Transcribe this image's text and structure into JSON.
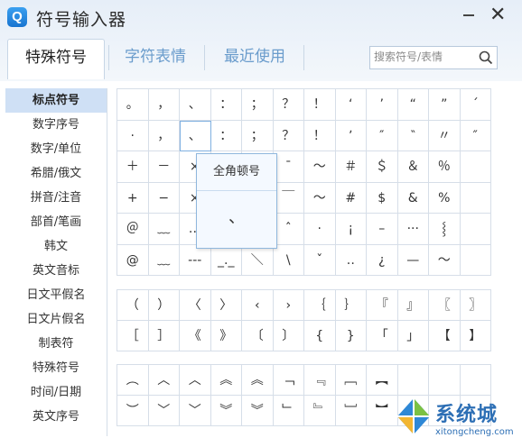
{
  "window": {
    "logo": "Q",
    "title": "符号输入器",
    "min_icon": "minimize-icon",
    "close_icon": "close-icon",
    "close_glyph": "✕"
  },
  "tabs": [
    {
      "label": "特殊符号",
      "active": true
    },
    {
      "label": "字符表情",
      "active": false
    },
    {
      "label": "最近使用",
      "active": false
    }
  ],
  "search": {
    "placeholder": "搜索符号/表情",
    "icon": "search-icon"
  },
  "sidebar": {
    "items": [
      {
        "label": "标点符号",
        "active": true
      },
      {
        "label": "数字序号"
      },
      {
        "label": "数字/单位"
      },
      {
        "label": "希腊/俄文"
      },
      {
        "label": "拼音/注音"
      },
      {
        "label": "部首/笔画"
      },
      {
        "label": "韩文"
      },
      {
        "label": "英文音标"
      },
      {
        "label": "日文平假名"
      },
      {
        "label": "日文片假名"
      },
      {
        "label": "制表符"
      },
      {
        "label": "特殊符号"
      },
      {
        "label": "时间/日期"
      },
      {
        "label": "英文序号"
      }
    ]
  },
  "symbols_group1": [
    [
      "。",
      "，",
      "、",
      "：",
      "；",
      "？",
      "！",
      "‘",
      "’",
      "“",
      "”",
      "ˊ"
    ],
    [
      "·",
      "，",
      "、",
      "：",
      "；",
      "？",
      "！",
      "ʼ",
      "″",
      "‶",
      "〃",
      "″"
    ],
    [
      "＋",
      "－",
      "×",
      "÷",
      "",
      "ˉ",
      "～",
      "＃",
      "＄",
      "＆",
      "％",
      ""
    ],
    [
      "+",
      "−",
      "×",
      "÷",
      "＿",
      "￣",
      "〜",
      "#",
      "$",
      "&",
      "%",
      ""
    ],
    [
      "＠",
      "﹏",
      "…",
      "",
      "‖",
      "ˆ",
      "·",
      "¡",
      "–",
      "···",
      "⸾",
      ""
    ],
    [
      "@",
      "﹏",
      "---",
      "_._",
      "＼",
      "\\",
      "ˇ",
      "‥",
      "¿",
      "—",
      "〜",
      ""
    ]
  ],
  "symbols_group2": [
    [
      "（",
      "）",
      "〈",
      "〉",
      "‹",
      "›",
      "｛",
      "｝",
      "『",
      "』",
      "〖",
      "〗"
    ],
    [
      "［",
      "］",
      "《",
      "》",
      "〔",
      "〕",
      "{",
      "}",
      "「",
      "」",
      "【",
      "】"
    ]
  ],
  "symbols_group3": [
    [
      "︵",
      "︿",
      "︿",
      "︽",
      "︽",
      "﹁",
      "﹃",
      "﹇",
      "︻",
      "",
      "",
      ""
    ],
    [
      "︶",
      "﹀",
      "﹀",
      "︾",
      "︾",
      "﹂",
      "﹄",
      "﹈",
      "︼",
      "",
      "",
      ""
    ]
  ],
  "popup": {
    "title": "全角顿号",
    "char": "、"
  },
  "watermark": {
    "text": "系统城",
    "url": "xitongcheng.com"
  },
  "colors": {
    "accent": "#1874d0",
    "tab_inactive": "#6a9ccc",
    "sidebar_active": "#cfe0f5"
  }
}
